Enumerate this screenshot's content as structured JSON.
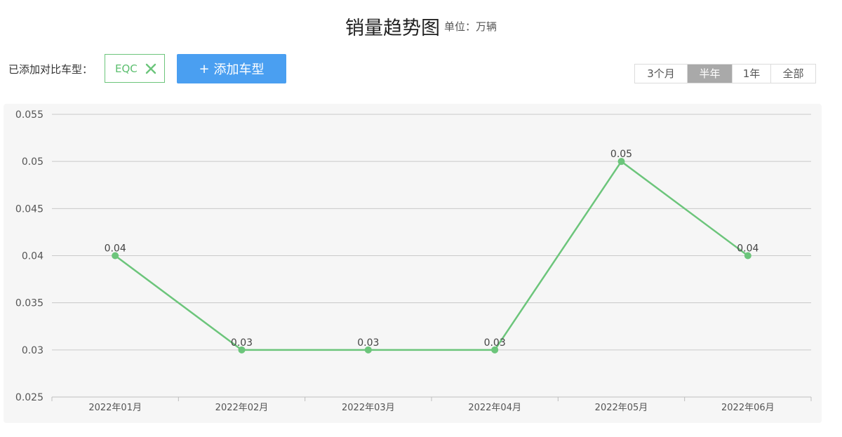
{
  "header": {
    "title": "销量趋势图",
    "unit": "单位：万辆"
  },
  "compare": {
    "label": "已添加对比车型：",
    "tags": [
      {
        "name": "EQC"
      }
    ],
    "add_label": "添加车型",
    "add_plus": "+"
  },
  "range": {
    "options": [
      "3个月",
      "半年",
      "1年",
      "全部"
    ],
    "active": "半年"
  },
  "colors": {
    "line": "#6cc57b",
    "accent": "#4a9ff1",
    "active_range": "#a9a9a9"
  },
  "chart_data": {
    "type": "line",
    "categories": [
      "2022年01月",
      "2022年02月",
      "2022年03月",
      "2022年04月",
      "2022年05月",
      "2022年06月"
    ],
    "series": [
      {
        "name": "EQC",
        "values": [
          0.04,
          0.03,
          0.03,
          0.03,
          0.05,
          0.04
        ]
      }
    ],
    "data_labels": [
      "0.04",
      "0.03",
      "0.03",
      "0.03",
      "0.05",
      "0.04"
    ],
    "yticks": [
      "0.025",
      "0.03",
      "0.035",
      "0.04",
      "0.045",
      "0.05",
      "0.055"
    ],
    "ylim": [
      0.025,
      0.055
    ],
    "grid": true,
    "title": "销量趋势图",
    "xlabel": "",
    "ylabel": ""
  }
}
